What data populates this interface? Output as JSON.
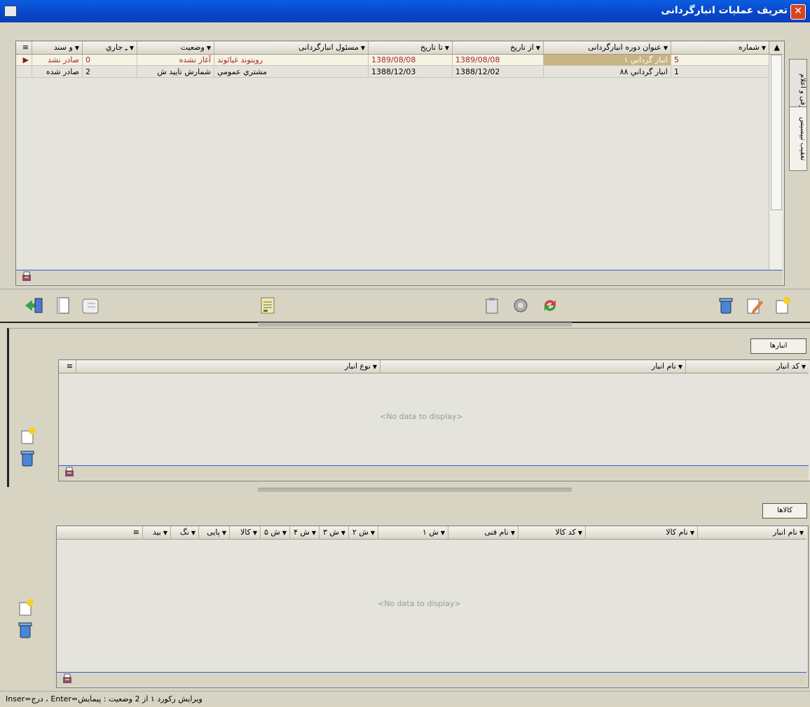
{
  "window": {
    "title": "تعریف عملیات انبارگردانی",
    "close": "✕"
  },
  "side_tabs": {
    "tab1": "معرفی و اعلام",
    "tab2": "تعقیب تیپسیس"
  },
  "top_grid": {
    "columns": [
      "شماره",
      "عنوان دوره انبارگردانی",
      "از تاریخ",
      "تا تاریخ",
      "مسئول انبارگردانی",
      "وضعیت",
      "ـِ جاري",
      "و سند"
    ],
    "rows": [
      {
        "num": "5",
        "title": "انبار گرداني ١",
        "from": "1389/08/08",
        "to": "1389/08/08",
        "resp": "رويتوند غيائوند",
        "status": "آغاز نشده",
        "cur": "0",
        "doc": "صادر نشد"
      },
      {
        "num": "1",
        "title": "انبار گرداني ٨٨",
        "from": "1388/12/02",
        "to": "1388/12/03",
        "resp": "مشتري عمومي",
        "status": "شمارش تایید ش",
        "cur": "2",
        "doc": "صادر شده"
      }
    ]
  },
  "mid_section": {
    "tab": "انبارها",
    "columns": [
      "کد انبار",
      "نام انبار",
      "نوع انبار"
    ],
    "empty": "<No data to display>"
  },
  "bottom_section": {
    "tab": "کالاها",
    "columns": [
      "نام انبار",
      "نام کالا",
      "کد کالا",
      "نام فنی",
      "ش ١",
      "ش ٢",
      "ش ٣",
      "ش ۴",
      "ش ۵",
      "کالا",
      "پایی",
      "نگ",
      "بید"
    ],
    "empty": "<No data to display>"
  },
  "status_bar": {
    "text": "Inser=درج ، Enter=ویرایش  رکورد ١ از 2      وضعیت : پیمایش"
  },
  "colors": {
    "accent": "#0a5ee0",
    "selected_cell": "#c8b483"
  }
}
